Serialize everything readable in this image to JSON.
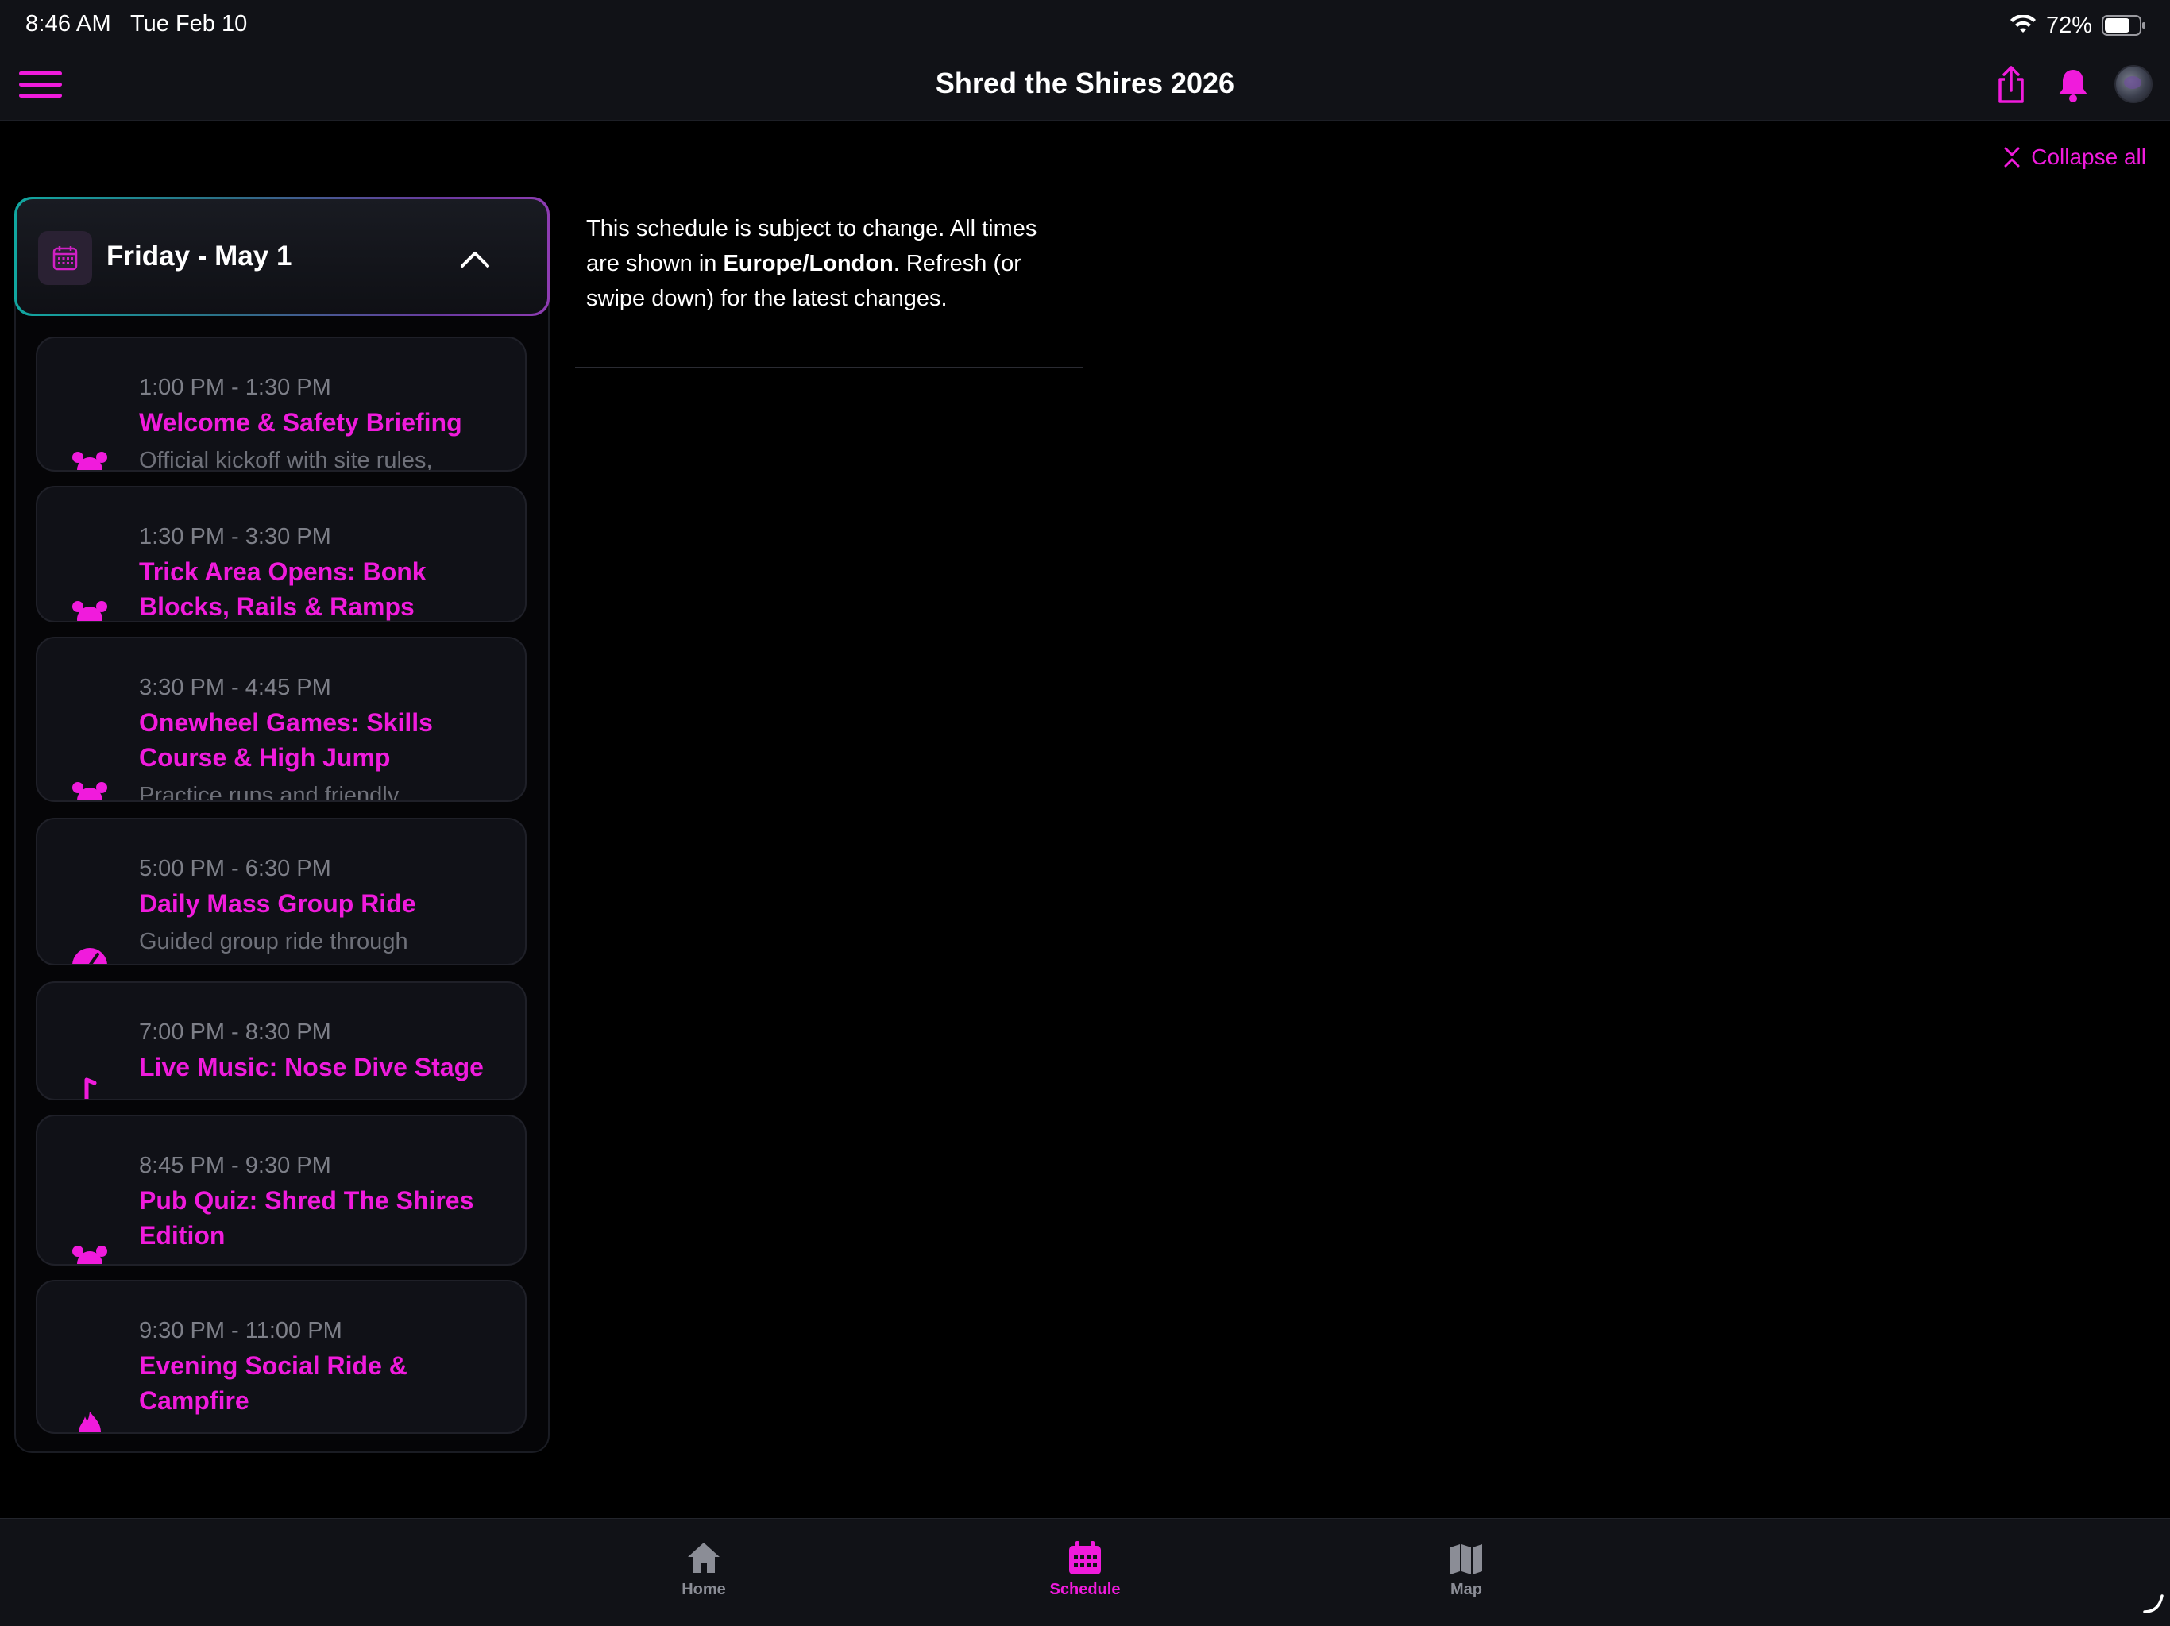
{
  "status_bar": {
    "time": "8:46 AM",
    "date": "Tue Feb 10",
    "battery": "72%"
  },
  "nav": {
    "title": "Shred the Shires 2026",
    "menu_icon": "hamburger-icon",
    "share_icon": "share-icon",
    "bell_icon": "bell-icon"
  },
  "collapse_all": "Collapse all",
  "day": {
    "title": "Friday - May 1",
    "icon": "calendar-icon"
  },
  "events": [
    {
      "time": "1:00 PM - 1:30 PM",
      "title": "Welcome & Safety Briefing",
      "desc": "Official kickoff with site rules,",
      "icon": "alarm-icon"
    },
    {
      "time": "1:30 PM - 3:30 PM",
      "title": "Trick Area Opens: Bonk Blocks, Rails & Ramps",
      "desc": "",
      "icon": "alarm-icon"
    },
    {
      "time": "3:30 PM - 4:45 PM",
      "title": "Onewheel Games: Skills Course & High Jump",
      "desc": "Practice runs and friendly",
      "icon": "alarm-icon"
    },
    {
      "time": "5:00 PM - 6:30 PM",
      "title": "Daily Mass Group Ride",
      "desc": "Guided group ride through",
      "icon": "speedometer-icon"
    },
    {
      "time": "7:00 PM - 8:30 PM",
      "title": "Live Music: Nose Dive Stage",
      "desc": "",
      "icon": "music-note-icon"
    },
    {
      "time": "8:45 PM - 9:30 PM",
      "title": "Pub Quiz: Shred The Shires Edition",
      "desc": "",
      "icon": "alarm-icon"
    },
    {
      "time": "9:30 PM - 11:00 PM",
      "title": "Evening Social Ride & Campfire",
      "desc": "",
      "icon": "fire-icon"
    }
  ],
  "notice": {
    "text_1": "This schedule is subject to change. All times are shown in ",
    "timezone": "Europe/London",
    "text_2": ". Refresh (or swipe down) for the latest changes."
  },
  "tabs": [
    {
      "label": "Home",
      "icon": "home-icon",
      "active": false
    },
    {
      "label": "Schedule",
      "icon": "calendar-icon",
      "active": true
    },
    {
      "label": "Map",
      "icon": "map-icon",
      "active": false
    }
  ],
  "colors": {
    "accent": "#f01bdc",
    "background": "#000000",
    "bar": "#111217",
    "card": "#101117",
    "muted_text": "#7d7f88"
  }
}
